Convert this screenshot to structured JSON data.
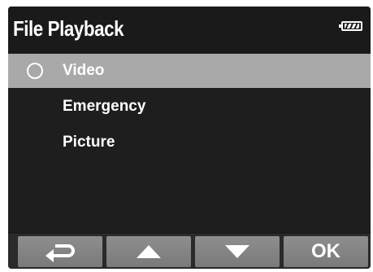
{
  "header": {
    "title": "File Playback",
    "battery_icon": "battery-full-icon"
  },
  "menu": {
    "items": [
      {
        "label": "Video",
        "selected": true
      },
      {
        "label": "Emergency",
        "selected": false
      },
      {
        "label": "Picture",
        "selected": false
      },
      {
        "label": "",
        "selected": false
      },
      {
        "label": "",
        "selected": false
      }
    ]
  },
  "buttons": {
    "back_icon": "return-arrow-icon",
    "up_icon": "triangle-up-icon",
    "down_icon": "triangle-down-icon",
    "ok_label": "OK"
  },
  "colors": {
    "selected_row": "#a9a9a9",
    "row": "#1e1e1e",
    "button": "#868686",
    "text": "#ffffff"
  }
}
